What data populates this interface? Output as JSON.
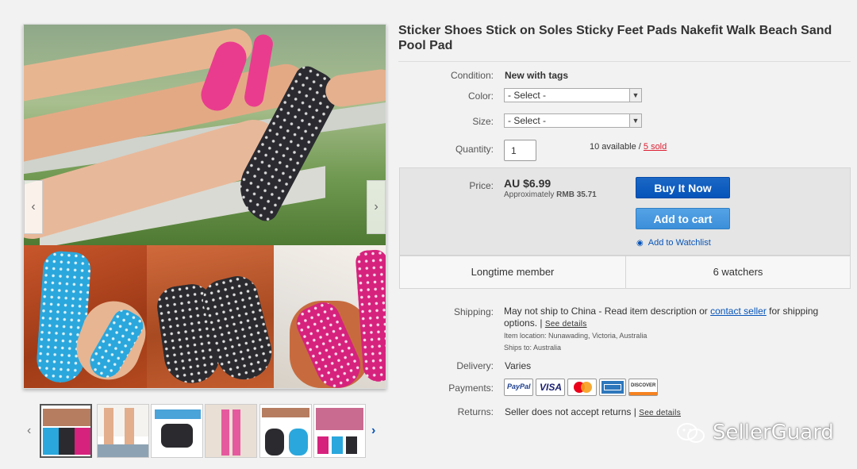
{
  "listing": {
    "title": "Sticker Shoes Stick on Soles Sticky Feet Pads Nakefit Walk Beach Sand Pool Pad"
  },
  "gallery": {
    "prev_arrow": "‹",
    "next_arrow": "›",
    "thumb_prev": "‹",
    "thumb_next": "›"
  },
  "details": {
    "condition_label": "Condition:",
    "condition_value": "New with tags",
    "color_label": "Color:",
    "color_select": "- Select -",
    "size_label": "Size:",
    "size_select": "- Select -",
    "quantity_label": "Quantity:",
    "quantity_value": "1",
    "available": "10 available / ",
    "sold": "5 sold"
  },
  "buybox": {
    "price_label": "Price:",
    "price": "AU $6.99",
    "approx_prefix": "Approximately ",
    "approx_value": "RMB 35.71",
    "buy_now": "Buy It Now",
    "add_to_cart": "Add to cart",
    "watchlist": "Add to Watchlist"
  },
  "stats": {
    "member": "Longtime member",
    "watchers": "6 watchers"
  },
  "shipping": {
    "label": "Shipping:",
    "text_1": "May not ship to China - Read item description or ",
    "contact_link": "contact seller",
    "text_2": " for shipping options. | ",
    "see_details": "See details",
    "location": "Item location:  Nunawading, Victoria, Australia",
    "ships_to": "Ships to:  Australia"
  },
  "delivery": {
    "label": "Delivery:",
    "value": "Varies"
  },
  "payments": {
    "label": "Payments:",
    "methods": [
      "PayPal",
      "VISA",
      "MasterCard",
      "American Express",
      "DISCOVER"
    ]
  },
  "returns": {
    "label": "Returns:",
    "value": "Seller does not accept returns | ",
    "see_details": "See details"
  },
  "watermark": {
    "text": "SellerGuard"
  },
  "colors": {
    "link_blue": "#0654ba",
    "buy_button": "#0654ba",
    "cart_button": "#3b8fd9",
    "sold_red": "#dd1e31"
  }
}
